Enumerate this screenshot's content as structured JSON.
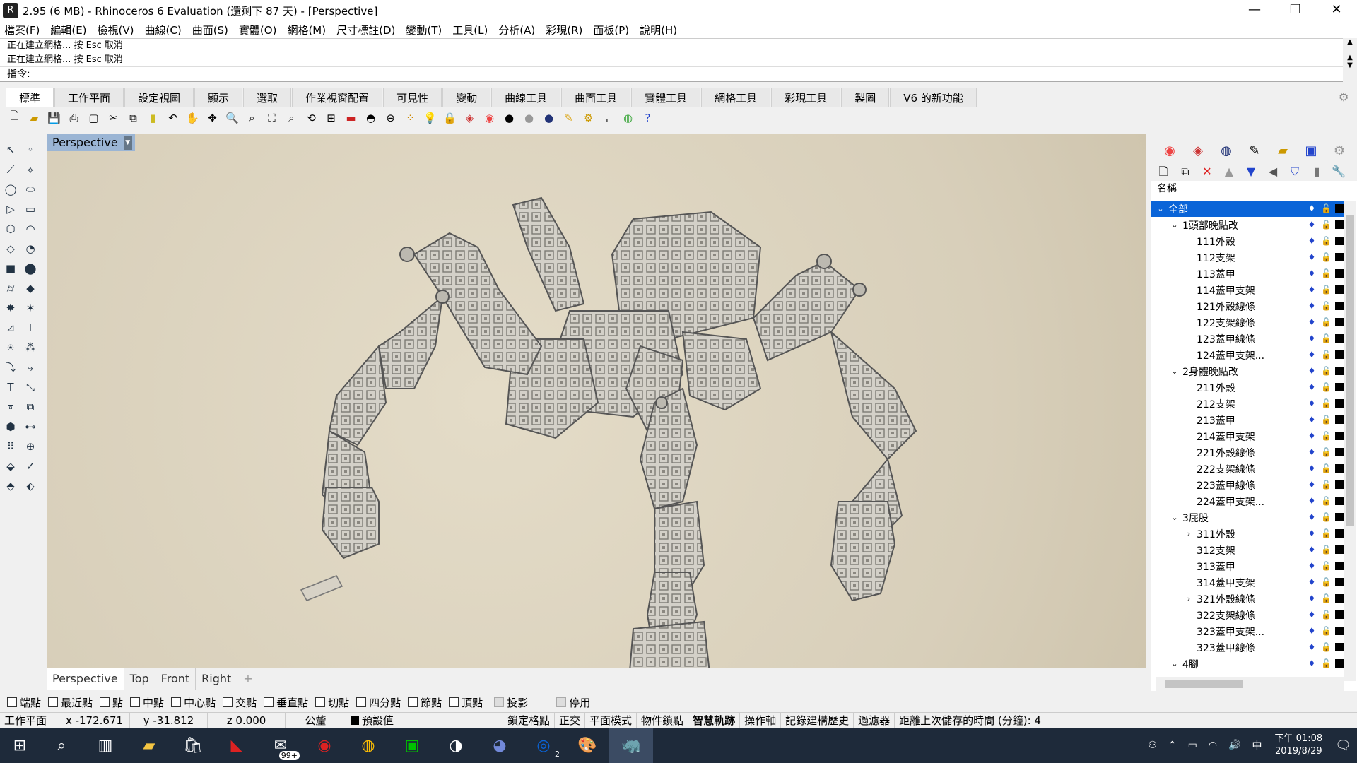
{
  "window": {
    "title": "2.95 (6 MB) - Rhinoceros 6 Evaluation (還剩下 87 天) - [Perspective]",
    "minimize": "—",
    "restore": "❐",
    "close": "✕"
  },
  "menu": [
    "檔案(F)",
    "編輯(E)",
    "檢視(V)",
    "曲線(C)",
    "曲面(S)",
    "實體(O)",
    "網格(M)",
    "尺寸標註(D)",
    "變動(T)",
    "工具(L)",
    "分析(A)",
    "彩現(R)",
    "面板(P)",
    "說明(H)"
  ],
  "command": {
    "history": [
      "正在建立網格... 按 Esc 取消",
      "正在建立網格... 按 Esc 取消"
    ],
    "prompt": "指令:"
  },
  "tabs": [
    "標準",
    "工作平面",
    "設定視圖",
    "顯示",
    "選取",
    "作業視窗配置",
    "可見性",
    "變動",
    "曲線工具",
    "曲面工具",
    "實體工具",
    "網格工具",
    "彩現工具",
    "製圖",
    "V6 的新功能"
  ],
  "viewport": {
    "title": "Perspective",
    "tabs": [
      "Perspective",
      "Top",
      "Front",
      "Right"
    ],
    "add_tab": "+"
  },
  "layers": {
    "header": "名稱",
    "rows": [
      {
        "name": "全部",
        "level": 0,
        "expanded": true,
        "selected": true
      },
      {
        "name": "1頭部晚點改",
        "level": 1,
        "expanded": true
      },
      {
        "name": "111外殼",
        "level": 2
      },
      {
        "name": "112支架",
        "level": 2
      },
      {
        "name": "113蓋甲",
        "level": 2
      },
      {
        "name": "114蓋甲支架",
        "level": 2
      },
      {
        "name": "121外殼線條",
        "level": 2
      },
      {
        "name": "122支架線條",
        "level": 2
      },
      {
        "name": "123蓋甲線條",
        "level": 2
      },
      {
        "name": "124蓋甲支架...",
        "level": 2
      },
      {
        "name": "2身體晚點改",
        "level": 1,
        "expanded": true
      },
      {
        "name": "211外殼",
        "level": 2
      },
      {
        "name": "212支架",
        "level": 2
      },
      {
        "name": "213蓋甲",
        "level": 2
      },
      {
        "name": "214蓋甲支架",
        "level": 2
      },
      {
        "name": "221外殼線條",
        "level": 2
      },
      {
        "name": "222支架線條",
        "level": 2
      },
      {
        "name": "223蓋甲線條",
        "level": 2
      },
      {
        "name": "224蓋甲支架...",
        "level": 2
      },
      {
        "name": "3屁股",
        "level": 1,
        "expanded": true
      },
      {
        "name": "311外殼",
        "level": 2,
        "collapsed": true
      },
      {
        "name": "312支架",
        "level": 2
      },
      {
        "name": "313蓋甲",
        "level": 2
      },
      {
        "name": "314蓋甲支架",
        "level": 2
      },
      {
        "name": "321外殼線條",
        "level": 2,
        "collapsed": true
      },
      {
        "name": "322支架線條",
        "level": 2
      },
      {
        "name": "323蓋甲支架...",
        "level": 2
      },
      {
        "name": "323蓋甲線條",
        "level": 2
      },
      {
        "name": "4腳",
        "level": 1,
        "expanded": true
      }
    ]
  },
  "osnaps": [
    {
      "label": "端點",
      "checked": false
    },
    {
      "label": "最近點",
      "checked": false
    },
    {
      "label": "點",
      "checked": false
    },
    {
      "label": "中點",
      "checked": false
    },
    {
      "label": "中心點",
      "checked": false
    },
    {
      "label": "交點",
      "checked": false
    },
    {
      "label": "垂直點",
      "checked": false
    },
    {
      "label": "切點",
      "checked": false
    },
    {
      "label": "四分點",
      "checked": false
    },
    {
      "label": "節點",
      "checked": false
    },
    {
      "label": "頂點",
      "checked": false
    },
    {
      "label": "投影",
      "checked": false,
      "disabled": true
    },
    {
      "label": "停用",
      "checked": false,
      "disabled": true
    }
  ],
  "status": {
    "cplane": "工作平面",
    "x": "x -172.671",
    "y": "y -31.812",
    "z": "z 0.000",
    "units": "公釐",
    "layer": "預設值",
    "grid_snap": "鎖定格點",
    "ortho": "正交",
    "planar": "平面模式",
    "osnap": "物件鎖點",
    "smarttrack": "智慧軌跡",
    "gumball": "操作軸",
    "history": "記錄建構歷史",
    "filter": "過濾器",
    "autosave": "距離上次儲存的時間 (分鐘): 4"
  },
  "taskbar": {
    "time": "下午 01:08",
    "date": "2019/8/29",
    "ime": "中",
    "badge_mail": "99+",
    "badge_outlook": "2"
  },
  "colors": {
    "selection": "#0a64d8",
    "viewport_bg": "#ddd4c0",
    "viewport_title": "#9bb5d4",
    "taskbar": "#1e2a3a"
  }
}
